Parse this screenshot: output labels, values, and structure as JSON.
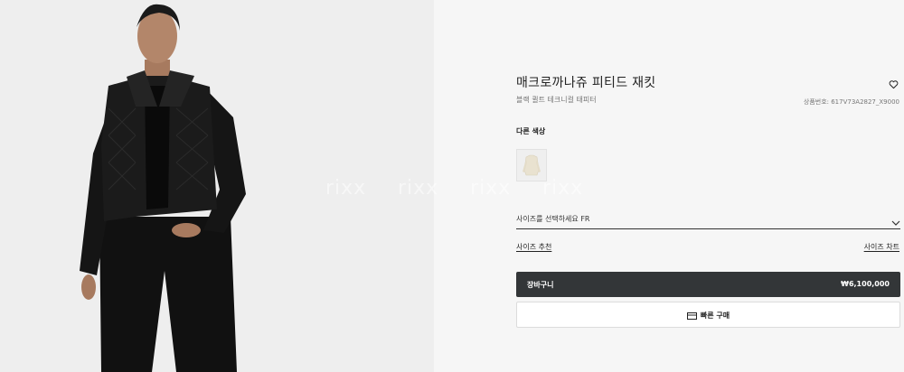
{
  "product": {
    "title": "매크로까나쥬 피티드 재킷",
    "subtitle": "블랙 퀼트 테크니컬 태피터",
    "sku": "상품번호: 617V73A2827_X9000"
  },
  "watermark": {
    "text": "rixx"
  },
  "colors": {
    "label": "다른 색상",
    "swatches": [
      {
        "name": "ivory",
        "color": "#ece6d6"
      }
    ]
  },
  "size": {
    "placeholder": "사이즈를 선택하세요 FR"
  },
  "links": {
    "size_recommend": "사이즈 추천",
    "size_chart": "사이즈 차트"
  },
  "cart": {
    "label": "장바구니",
    "price": "₩6,100,000"
  },
  "quick_buy": {
    "label": "빠른 구매"
  },
  "icons": {
    "wishlist": "heart-icon",
    "dropdown": "chevron-down-icon",
    "quick_buy": "card-icon"
  },
  "theme": {
    "cart_button_bg": "#333638",
    "left_bg": "#eeeeee",
    "right_bg": "#f6f6f6"
  }
}
